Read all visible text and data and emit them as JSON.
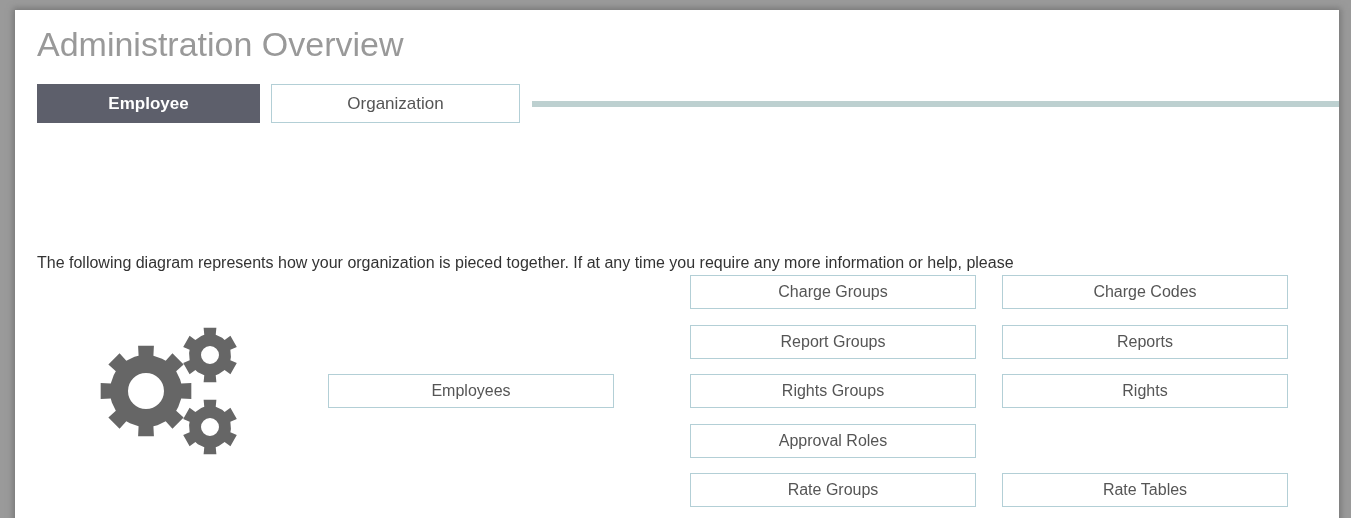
{
  "title": "Administration Overview",
  "tabs": [
    {
      "label": "Employee",
      "selected": true
    },
    {
      "label": "Organization",
      "selected": false
    }
  ],
  "description": "The following diagram represents how your organization is pieced together. If at any time you require any more information or help, please",
  "diagram": {
    "root": "Employees",
    "rows": [
      {
        "cells": [
          "Charge Groups",
          "Charge Codes"
        ]
      },
      {
        "cells": [
          "Report Groups",
          "Reports"
        ]
      },
      {
        "cells": [
          "Rights Groups",
          "Rights"
        ]
      },
      {
        "cells": [
          "Approval Roles"
        ]
      },
      {
        "cells": [
          "Rate Groups",
          "Rate Tables"
        ]
      }
    ]
  }
}
